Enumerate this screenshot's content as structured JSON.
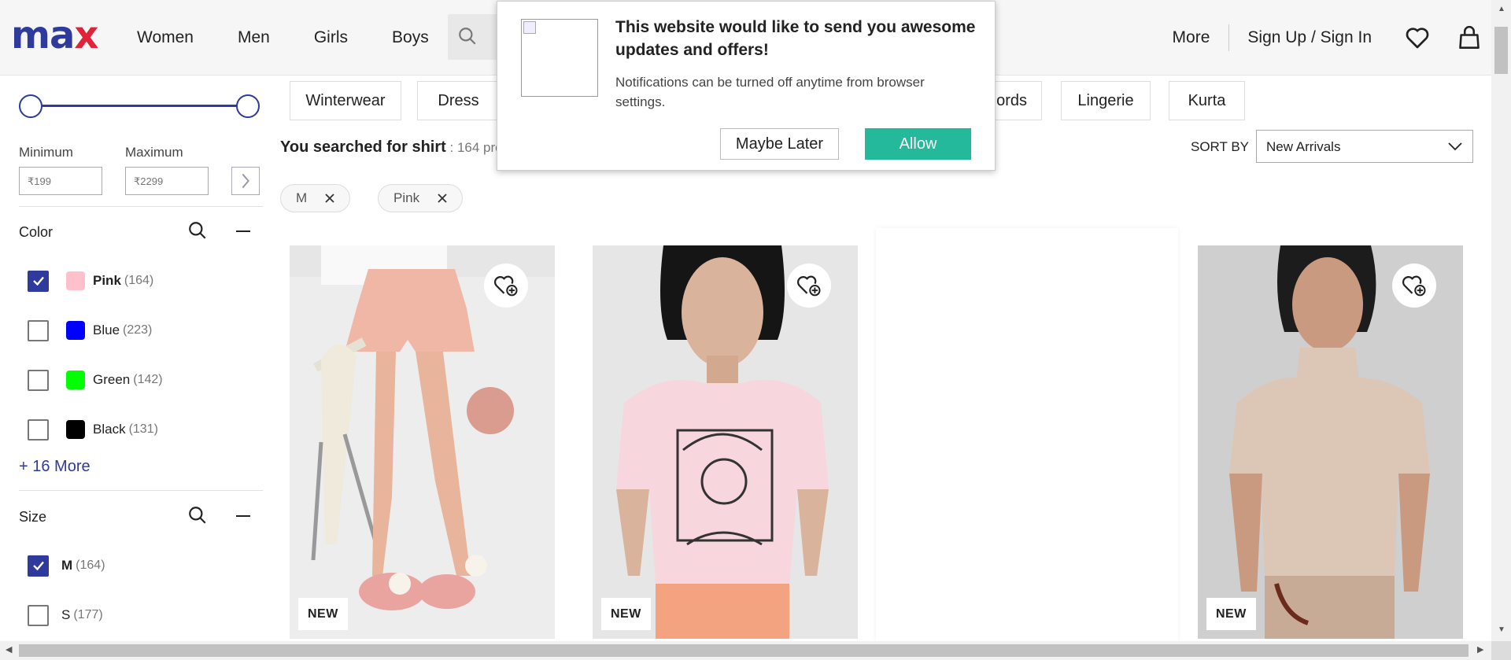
{
  "header": {
    "logo_part1": "ma",
    "logo_part2": "x",
    "nav": [
      "Women",
      "Men",
      "Girls",
      "Boys"
    ],
    "more": "More",
    "sign_in": "Sign Up / Sign In"
  },
  "popup": {
    "title": "This website would like to send you awesome updates and offers!",
    "text": "Notifications can be turned off anytime from browser settings.",
    "later": "Maybe Later",
    "allow": "Allow"
  },
  "price": {
    "min_label": "Minimum",
    "max_label": "Maximum",
    "min_placeholder": "₹199",
    "max_placeholder": "₹2299"
  },
  "color_facet": {
    "title": "Color",
    "options": [
      {
        "label": "Pink",
        "count": "(164)",
        "checked": true,
        "color": "#ffc0cb"
      },
      {
        "label": "Blue",
        "count": "(223)",
        "checked": false,
        "color": "#0000ff"
      },
      {
        "label": "Green",
        "count": "(142)",
        "checked": false,
        "color": "#00ff00"
      },
      {
        "label": "Black",
        "count": "(131)",
        "checked": false,
        "color": "#000000"
      }
    ],
    "more": "+ 16 More"
  },
  "size_facet": {
    "title": "Size",
    "options": [
      {
        "label": "M",
        "count": "(164)",
        "checked": true
      },
      {
        "label": "S",
        "count": "(177)",
        "checked": false
      }
    ]
  },
  "categories": [
    "Winterwear",
    "Dress",
    "ords",
    "Lingerie",
    "Kurta"
  ],
  "search": {
    "prefix": "You searched for shirt",
    "count": " : 164 pro"
  },
  "sort": {
    "label": "SORT BY",
    "value": "New Arrivals"
  },
  "filters": [
    "M",
    "Pink"
  ],
  "products": [
    {
      "badge": "NEW"
    },
    {
      "badge": "NEW"
    },
    {
      "badge": ""
    },
    {
      "badge": "NEW"
    }
  ],
  "colors": {
    "brand_blue": "#2e3a9c",
    "brand_red": "#e0223a",
    "allow_green": "#24b99a"
  }
}
